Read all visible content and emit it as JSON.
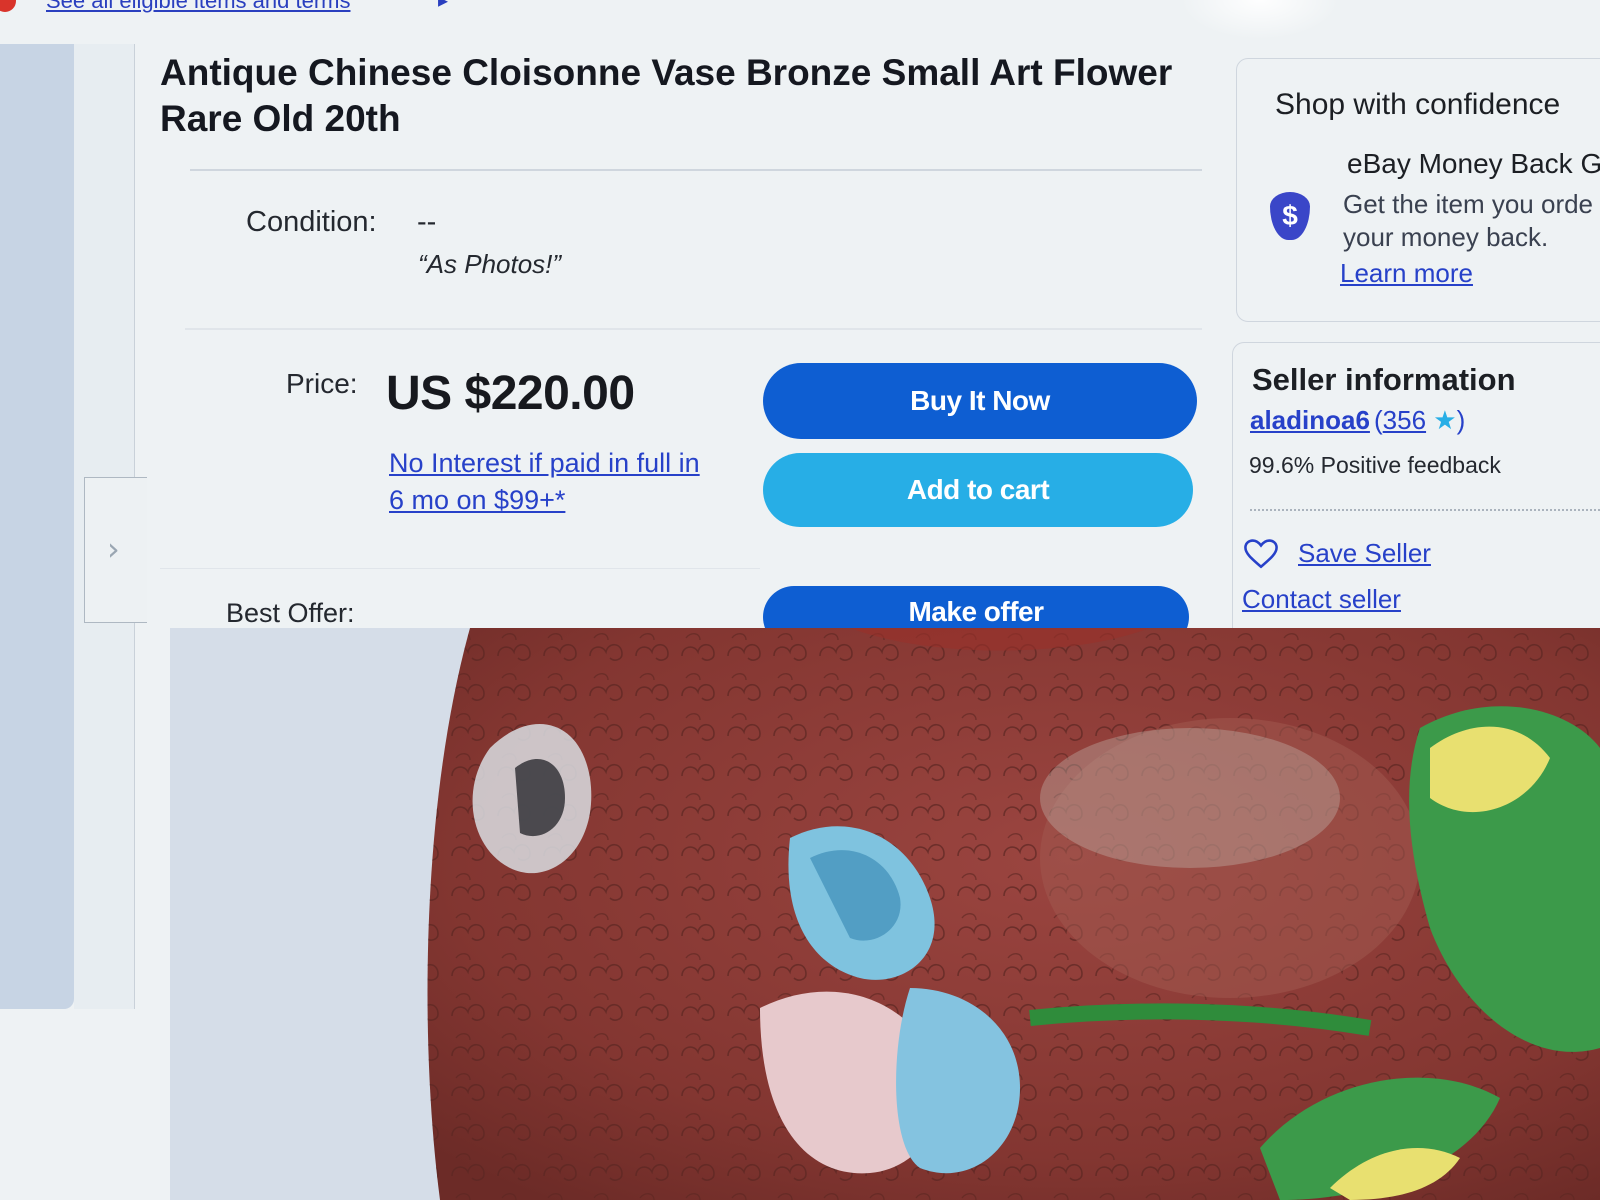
{
  "top_link": {
    "label": "See all eligible items and terms"
  },
  "item": {
    "title": "Antique Chinese Cloisonne Vase Bronze Small Art Flower Rare Old 20th"
  },
  "condition": {
    "label": "Condition:",
    "value": "--",
    "note": "“As Photos!”"
  },
  "price": {
    "label": "Price:",
    "value": "US $220.00",
    "financing_line1": "No Interest if paid in full in",
    "financing_line2": "6 mo on $99+*"
  },
  "buttons": {
    "buy_now": "Buy It Now",
    "add_to_cart": "Add to cart",
    "make_offer": "Make offer"
  },
  "best_offer": {
    "label": "Best Offer:"
  },
  "confidence": {
    "title": "Shop with confidence",
    "guarantee_title": "eBay Money Back G",
    "guarantee_desc_line1": "Get the item you orde",
    "guarantee_desc_line2": "your money back.",
    "learn_more": "Learn more",
    "shield_symbol": "$"
  },
  "seller": {
    "title": "Seller information",
    "name": "aladinoa6",
    "open_paren": "(",
    "rating_count": "356",
    "star": "★",
    "close_paren": ")",
    "feedback": "99.6% Positive feedback",
    "save_seller": "Save Seller",
    "contact_seller": "Contact seller"
  },
  "icons": {
    "nav": "chevron-right-icon",
    "shield": "shield-dollar-icon",
    "heart": "heart-icon"
  },
  "nav": {
    "chevron": "›"
  },
  "colors": {
    "primary_button": "#0e5ed2",
    "secondary_button": "#27aee6",
    "link": "#2741c9",
    "vase_red": "#8c3a34"
  }
}
